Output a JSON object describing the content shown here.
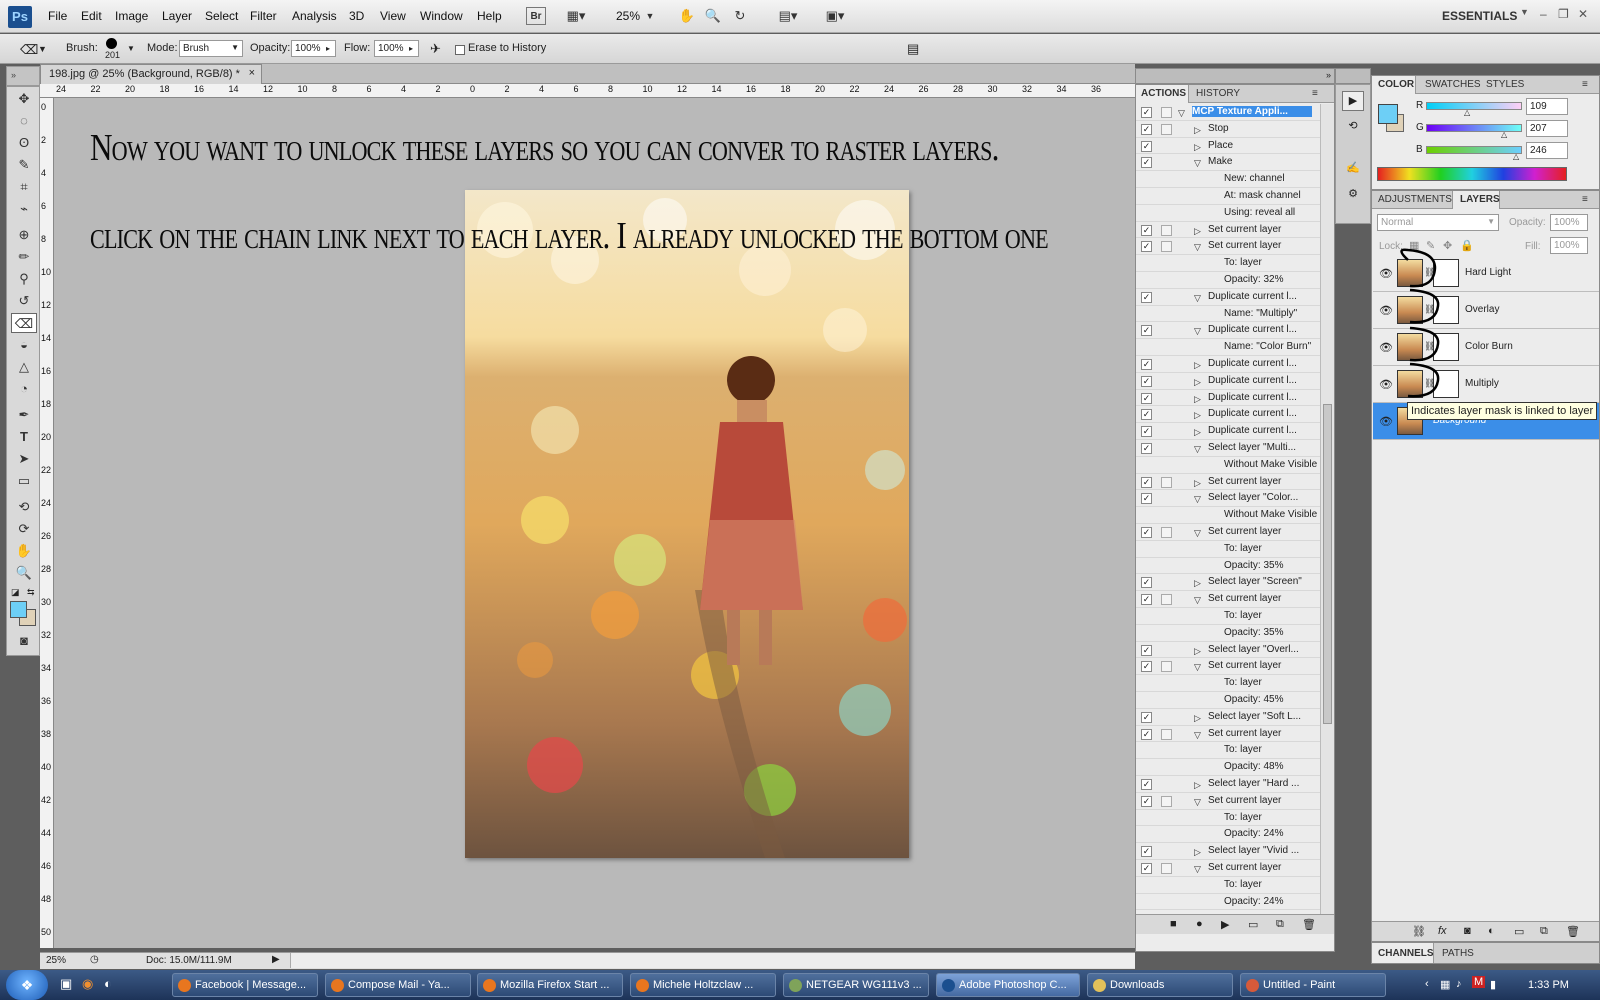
{
  "menubar": {
    "logo": "Ps",
    "items": [
      "File",
      "Edit",
      "Image",
      "Layer",
      "Select",
      "Filter",
      "Analysis",
      "3D",
      "View",
      "Window",
      "Help"
    ],
    "bridge_label": "Br",
    "zoom": "25%",
    "workspace": "ESSENTIALS"
  },
  "options": {
    "brush_label": "Brush:",
    "brush_size": "201",
    "mode_label": "Mode:",
    "mode_value": "Brush",
    "opacity_label": "Opacity:",
    "opacity_value": "100%",
    "flow_label": "Flow:",
    "flow_value": "100%",
    "erase_history": "Erase to History"
  },
  "document": {
    "tab_title": "198.jpg @ 25% (Background, RGB/8) *",
    "caption_line1": "Now you want to unlock these layers so you can conver to raster layers.",
    "caption_line2": "click on the chain link next to each layer. I already unlocked the bottom one",
    "ruler_top": [
      "24",
      "22",
      "20",
      "18",
      "16",
      "14",
      "12",
      "10",
      "8",
      "6",
      "4",
      "2",
      "0",
      "2",
      "4",
      "6",
      "8",
      "10",
      "12",
      "14",
      "16",
      "18",
      "20",
      "22",
      "24",
      "26",
      "28",
      "30",
      "32",
      "34",
      "36"
    ],
    "ruler_left": [
      "0",
      "2",
      "4",
      "6",
      "8",
      "10",
      "12",
      "14",
      "16",
      "18",
      "20",
      "22",
      "24",
      "26",
      "28",
      "30",
      "32",
      "34",
      "36",
      "38",
      "40",
      "42",
      "44",
      "46",
      "48",
      "50"
    ],
    "status_zoom": "25%",
    "status_doc": "Doc: 15.0M/111.9M"
  },
  "actions_panel": {
    "tab_actions": "ACTIONS",
    "tab_history": "HISTORY",
    "rows": [
      {
        "text": "MCP Texture Appli...",
        "level": 0,
        "open": true,
        "check": true,
        "dialog": true,
        "selected": true
      },
      {
        "text": "Stop",
        "level": 1,
        "open": false,
        "check": true,
        "dialog": true
      },
      {
        "text": "Place",
        "level": 1,
        "open": false,
        "check": true,
        "dialog": false
      },
      {
        "text": "Make",
        "level": 1,
        "open": true,
        "check": true,
        "dialog": false
      },
      {
        "text": "New: channel",
        "level": 2,
        "open": null,
        "check": false,
        "dialog": false
      },
      {
        "text": "At: mask channel",
        "level": 2,
        "open": null,
        "check": false,
        "dialog": false
      },
      {
        "text": "Using: reveal all",
        "level": 2,
        "open": null,
        "check": false,
        "dialog": false
      },
      {
        "text": "Set current layer",
        "level": 1,
        "open": false,
        "check": true,
        "dialog": true
      },
      {
        "text": "Set current layer",
        "level": 1,
        "open": true,
        "check": true,
        "dialog": true
      },
      {
        "text": "To: layer",
        "level": 2,
        "open": null,
        "check": false,
        "dialog": false
      },
      {
        "text": "Opacity: 32%",
        "level": 2,
        "open": null,
        "check": false,
        "dialog": false
      },
      {
        "text": "Duplicate current l...",
        "level": 1,
        "open": true,
        "check": true,
        "dialog": false
      },
      {
        "text": "Name: \"Multiply\"",
        "level": 2,
        "open": null,
        "check": false,
        "dialog": false
      },
      {
        "text": "Duplicate current l...",
        "level": 1,
        "open": true,
        "check": true,
        "dialog": false
      },
      {
        "text": "Name: \"Color Burn\"",
        "level": 2,
        "open": null,
        "check": false,
        "dialog": false
      },
      {
        "text": "Duplicate current l...",
        "level": 1,
        "open": false,
        "check": true,
        "dialog": false
      },
      {
        "text": "Duplicate current l...",
        "level": 1,
        "open": false,
        "check": true,
        "dialog": false
      },
      {
        "text": "Duplicate current l...",
        "level": 1,
        "open": false,
        "check": true,
        "dialog": false
      },
      {
        "text": "Duplicate current l...",
        "level": 1,
        "open": false,
        "check": true,
        "dialog": false
      },
      {
        "text": "Duplicate current l...",
        "level": 1,
        "open": false,
        "check": true,
        "dialog": false
      },
      {
        "text": "Select layer \"Multi...",
        "level": 1,
        "open": true,
        "check": true,
        "dialog": false
      },
      {
        "text": "Without Make Visible",
        "level": 2,
        "open": null,
        "check": false,
        "dialog": false
      },
      {
        "text": "Set current layer",
        "level": 1,
        "open": false,
        "check": true,
        "dialog": true
      },
      {
        "text": "Select layer \"Color...",
        "level": 1,
        "open": true,
        "check": true,
        "dialog": false
      },
      {
        "text": "Without Make Visible",
        "level": 2,
        "open": null,
        "check": false,
        "dialog": false
      },
      {
        "text": "Set current layer",
        "level": 1,
        "open": true,
        "check": true,
        "dialog": true
      },
      {
        "text": "To: layer",
        "level": 2,
        "open": null,
        "check": false,
        "dialog": false
      },
      {
        "text": "Opacity: 35%",
        "level": 2,
        "open": null,
        "check": false,
        "dialog": false
      },
      {
        "text": "Select layer \"Screen\"",
        "level": 1,
        "open": false,
        "check": true,
        "dialog": false
      },
      {
        "text": "Set current layer",
        "level": 1,
        "open": true,
        "check": true,
        "dialog": true
      },
      {
        "text": "To: layer",
        "level": 2,
        "open": null,
        "check": false,
        "dialog": false
      },
      {
        "text": "Opacity: 35%",
        "level": 2,
        "open": null,
        "check": false,
        "dialog": false
      },
      {
        "text": "Select layer \"Overl...",
        "level": 1,
        "open": false,
        "check": true,
        "dialog": false
      },
      {
        "text": "Set current layer",
        "level": 1,
        "open": true,
        "check": true,
        "dialog": true
      },
      {
        "text": "To: layer",
        "level": 2,
        "open": null,
        "check": false,
        "dialog": false
      },
      {
        "text": "Opacity: 45%",
        "level": 2,
        "open": null,
        "check": false,
        "dialog": false
      },
      {
        "text": "Select layer \"Soft L...",
        "level": 1,
        "open": false,
        "check": true,
        "dialog": false
      },
      {
        "text": "Set current layer",
        "level": 1,
        "open": true,
        "check": true,
        "dialog": true
      },
      {
        "text": "To: layer",
        "level": 2,
        "open": null,
        "check": false,
        "dialog": false
      },
      {
        "text": "Opacity: 48%",
        "level": 2,
        "open": null,
        "check": false,
        "dialog": false
      },
      {
        "text": "Select layer \"Hard ...",
        "level": 1,
        "open": false,
        "check": true,
        "dialog": false
      },
      {
        "text": "Set current layer",
        "level": 1,
        "open": true,
        "check": true,
        "dialog": true
      },
      {
        "text": "To: layer",
        "level": 2,
        "open": null,
        "check": false,
        "dialog": false
      },
      {
        "text": "Opacity: 24%",
        "level": 2,
        "open": null,
        "check": false,
        "dialog": false
      },
      {
        "text": "Select layer \"Vivid ...",
        "level": 1,
        "open": false,
        "check": true,
        "dialog": false
      },
      {
        "text": "Set current layer",
        "level": 1,
        "open": true,
        "check": true,
        "dialog": true
      },
      {
        "text": "To: layer",
        "level": 2,
        "open": null,
        "check": false,
        "dialog": false
      },
      {
        "text": "Opacity: 24%",
        "level": 2,
        "open": null,
        "check": false,
        "dialog": false
      }
    ]
  },
  "color_panel": {
    "tab_color": "COLOR",
    "tab_swatches": "SWATCHES",
    "tab_styles": "STYLES",
    "r_label": "R",
    "r_value": "109",
    "g_label": "G",
    "g_value": "207",
    "b_label": "B",
    "b_value": "246",
    "foreground": "#6dcff6"
  },
  "layers_panel": {
    "tab_adjustments": "ADJUSTMENTS",
    "tab_layers": "LAYERS",
    "blend_mode": "Normal",
    "opacity_label": "Opacity:",
    "opacity_value": "100%",
    "lock_label": "Lock:",
    "fill_label": "Fill:",
    "fill_value": "100%",
    "layers": [
      {
        "name": "Hard Light",
        "selected": false
      },
      {
        "name": "Overlay",
        "selected": false
      },
      {
        "name": "Color Burn",
        "selected": false
      },
      {
        "name": "Multiply",
        "selected": false
      },
      {
        "name": "Background",
        "selected": true
      }
    ],
    "tooltip": "Indicates layer mask is linked to layer",
    "tab_channels": "CHANNELS",
    "tab_paths": "PATHS"
  },
  "taskbar": {
    "tasks": [
      {
        "label": "Facebook | Message...",
        "icon_color": "#e8761f",
        "active": false
      },
      {
        "label": "Compose Mail - Ya...",
        "icon_color": "#e8761f",
        "active": false
      },
      {
        "label": "Mozilla Firefox Start ...",
        "icon_color": "#e8761f",
        "active": false
      },
      {
        "label": "Michele Holtzclaw ...",
        "icon_color": "#e8761f",
        "active": false
      },
      {
        "label": "NETGEAR WG111v3 ...",
        "icon_color": "#7fa35a",
        "active": false
      },
      {
        "label": "Adobe Photoshop C...",
        "icon_color": "#1b4f8f",
        "active": true
      },
      {
        "label": "Downloads",
        "icon_color": "#e3c15a",
        "active": false
      },
      {
        "label": "Untitled - Paint",
        "icon_color": "#d65a3a",
        "active": false
      }
    ],
    "clock": "1:33 PM"
  }
}
